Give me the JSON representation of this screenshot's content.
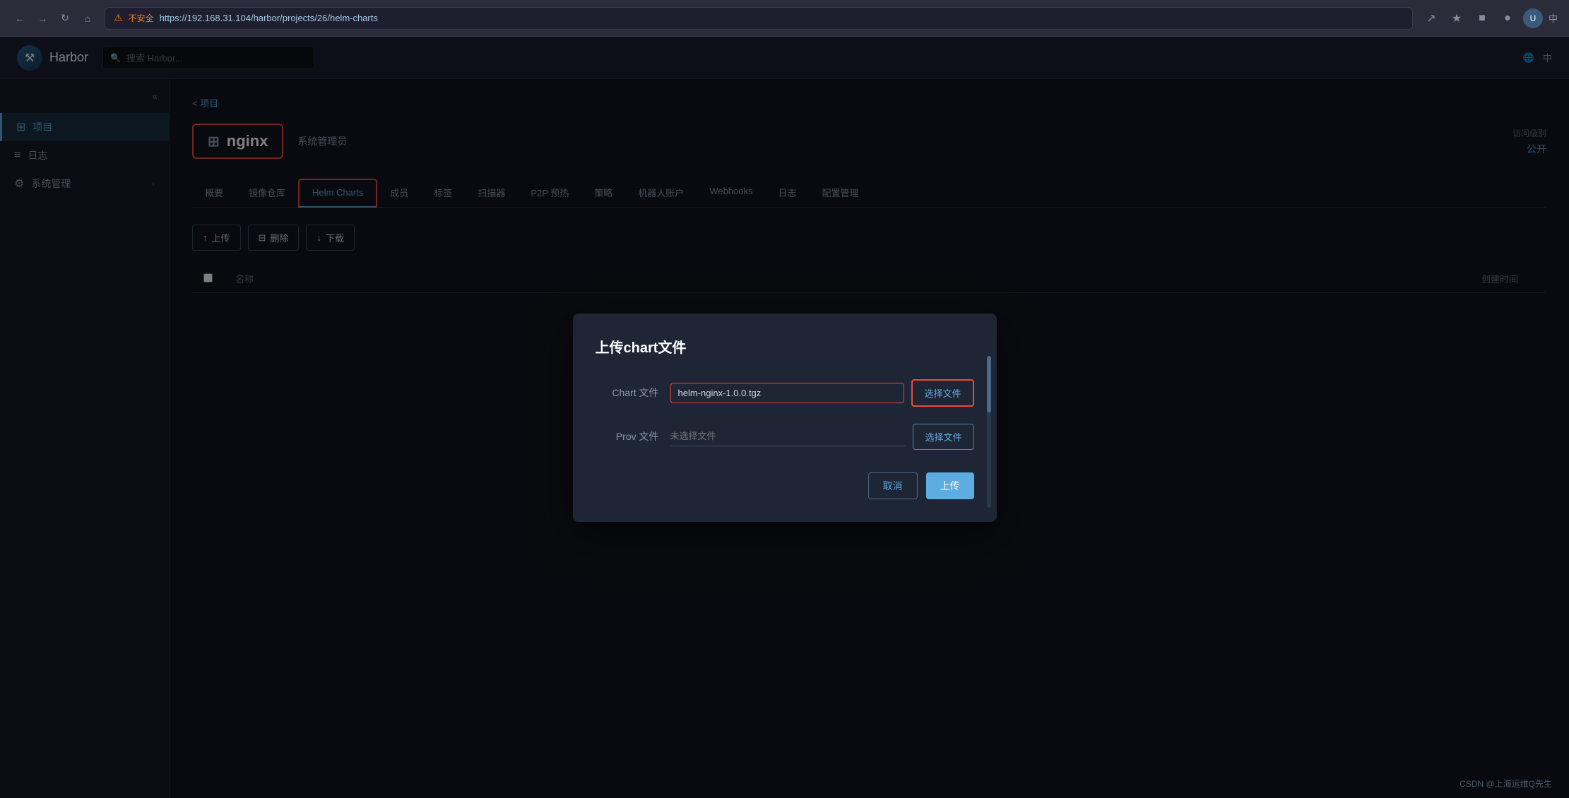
{
  "browser": {
    "url": "https://192.168.31.104/harbor/projects/26/helm-charts",
    "url_display": "https://192.168.31.104/harbor/projects/26/helm-charts",
    "warning_text": "不安全",
    "lang_label": "中"
  },
  "topnav": {
    "app_name": "Harbor",
    "search_placeholder": "搜索 Harbor...",
    "lang_label": "中"
  },
  "sidebar": {
    "collapse_icon": "«",
    "items": [
      {
        "label": "项目",
        "icon": "⊞",
        "active": true
      },
      {
        "label": "日志",
        "icon": "≡",
        "active": false
      },
      {
        "label": "系统管理",
        "icon": "⚙",
        "active": false,
        "expandable": true
      }
    ]
  },
  "breadcrumb": {
    "link": "< 项目"
  },
  "project": {
    "icon": "⊞",
    "name": "nginx",
    "role": "系统管理员",
    "access_label": "访问级别",
    "access_value": "公开"
  },
  "tabs": [
    {
      "label": "概要",
      "active": false
    },
    {
      "label": "镜像仓库",
      "active": false
    },
    {
      "label": "Helm Charts",
      "active": true
    },
    {
      "label": "成员",
      "active": false
    },
    {
      "label": "标签",
      "active": false
    },
    {
      "label": "扫描器",
      "active": false
    },
    {
      "label": "P2P 预热",
      "active": false
    },
    {
      "label": "策略",
      "active": false
    },
    {
      "label": "机器人账户",
      "active": false
    },
    {
      "label": "Webhooks",
      "active": false
    },
    {
      "label": "日志",
      "active": false
    },
    {
      "label": "配置管理",
      "active": false
    }
  ],
  "toolbar": {
    "upload_label": "↑ 上传",
    "delete_label": "⊟ 删除",
    "download_label": "↓ 下载"
  },
  "table": {
    "col_checkbox": "",
    "col_name": "名称",
    "col_created": "创建时间",
    "rows": []
  },
  "modal": {
    "title": "上传chart文件",
    "chart_label": "Chart 文件",
    "chart_value": "helm-nginx-1.0.0.tgz",
    "chart_placeholder": "helm-nginx-1.0.0.tgz",
    "chart_choose_label": "选择文件",
    "prov_label": "Prov 文件",
    "prov_placeholder": "未选择文件",
    "prov_choose_label": "选择文件",
    "cancel_label": "取消",
    "upload_label": "上传"
  },
  "watermark": {
    "text": "CSDN @上海运维Q先生"
  }
}
